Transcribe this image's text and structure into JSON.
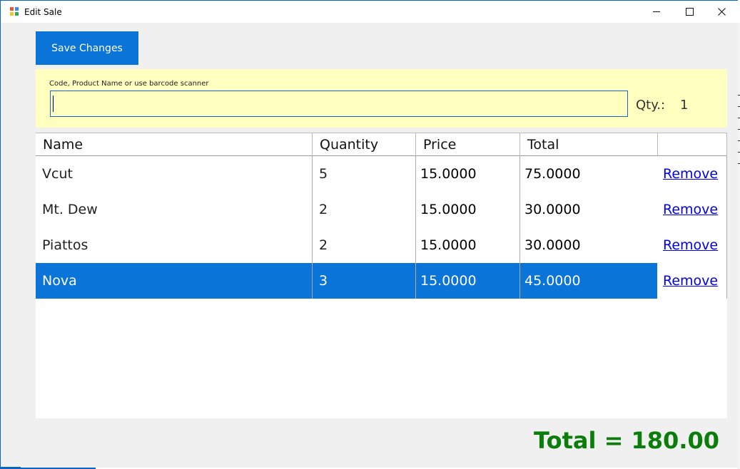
{
  "window": {
    "title": "Edit Sale"
  },
  "toolbar": {
    "save_label": "Save Changes"
  },
  "search": {
    "label": "Code, Product Name or use barcode scanner",
    "value": "",
    "qty_label": "Qty.:",
    "qty_value": "1"
  },
  "grid": {
    "columns": [
      "Name",
      "Quantity",
      "Price",
      "Total",
      ""
    ],
    "rows": [
      {
        "name": "Vcut",
        "quantity": "5",
        "price": "15.0000",
        "total": "75.0000",
        "action": "Remove"
      },
      {
        "name": "Mt. Dew",
        "quantity": "2",
        "price": "15.0000",
        "total": "30.0000",
        "action": "Remove"
      },
      {
        "name": "Piattos",
        "quantity": "2",
        "price": "15.0000",
        "total": "30.0000",
        "action": "Remove"
      },
      {
        "name": "Nova",
        "quantity": "3",
        "price": "15.0000",
        "total": "45.0000",
        "action": "Remove"
      }
    ],
    "selected_row": 3
  },
  "summary": {
    "total_text": "Total = 180.00"
  },
  "colors": {
    "accent": "#0a74d8",
    "panel": "#ffffc0",
    "total": "#0a7d0a",
    "link": "#0000ee"
  },
  "icons": {
    "app": "app-window-icon",
    "minimize": "minimize-icon",
    "maximize": "maximize-icon",
    "close": "close-icon"
  }
}
